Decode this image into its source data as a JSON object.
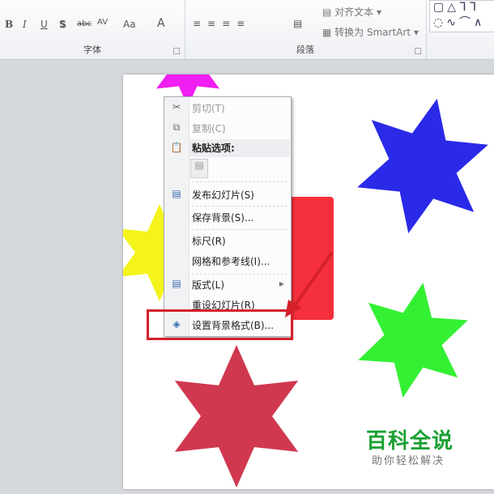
{
  "ribbon": {
    "font_group": {
      "label": "字体",
      "buttons": [
        "B",
        "I",
        "U",
        "S",
        "abc",
        "AV",
        "Aa",
        "A"
      ]
    },
    "paragraph_group": {
      "label": "段落",
      "align_text": "对齐文本",
      "convert_smartart": "转换为 SmartArt"
    }
  },
  "context_menu": {
    "items": [
      {
        "label": "剪切(T)",
        "icon": "scissors-icon",
        "disabled": true
      },
      {
        "label": "复制(C)",
        "icon": "copy-icon",
        "disabled": true
      },
      {
        "label": "粘贴选项:",
        "icon": "paste-icon",
        "header": true
      },
      {
        "label": "发布幻灯片(S)",
        "icon": "publish-icon"
      },
      {
        "label": "保存背景(S)..."
      },
      {
        "label": "标尺(R)"
      },
      {
        "label": "网格和参考线(I)..."
      },
      {
        "label": "版式(L)",
        "icon": "layout-icon",
        "submenu": true
      },
      {
        "label": "重设幻灯片(R)"
      },
      {
        "label": "设置背景格式(B)...",
        "icon": "format-background-icon",
        "highlighted": true
      }
    ]
  },
  "watermark": {
    "title": "百科全说",
    "subtitle": "助你轻松解决"
  },
  "colors": {
    "highlight": "#d4202a",
    "blue": "#2a2ae8",
    "green": "#33f033",
    "crimson": "#d0384f",
    "red": "#f52f3c",
    "yellow": "#f4f41c",
    "magenta": "#f01ef0"
  }
}
